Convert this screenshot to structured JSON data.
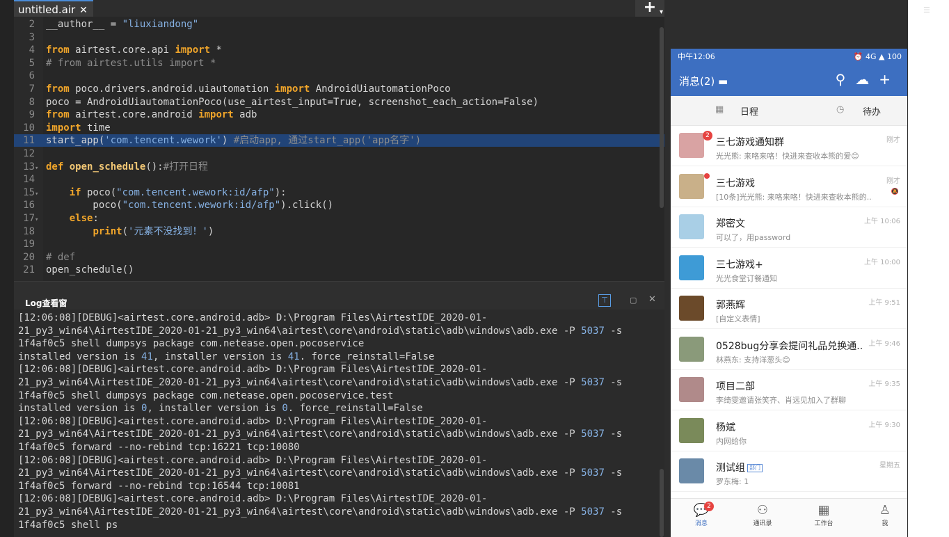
{
  "ide": {
    "tab_label": "untitled.air",
    "tab_close": "✕",
    "new_button": "+",
    "code_lines": [
      {
        "n": "2",
        "fold": "",
        "html": "__author__ = <span class=\"str\">\"liuxiandong\"</span>"
      },
      {
        "n": "3",
        "fold": "",
        "html": ""
      },
      {
        "n": "4",
        "fold": "",
        "html": "<span class=\"kw\">from</span> airtest.core.api <span class=\"kw\">import</span> *"
      },
      {
        "n": "5",
        "fold": "",
        "html": "<span class=\"cm\"># from airtest.utils import *</span>"
      },
      {
        "n": "6",
        "fold": "",
        "html": ""
      },
      {
        "n": "7",
        "fold": "",
        "html": "<span class=\"kw\">from</span> poco.drivers.android.uiautomation <span class=\"kw\">import</span> AndroidUiautomationPoco"
      },
      {
        "n": "8",
        "fold": "",
        "html": "poco = AndroidUiautomationPoco(use_airtest_input=True, screenshot_each_action=False)"
      },
      {
        "n": "9",
        "fold": "",
        "html": "<span class=\"kw\">from</span> airtest.core.android <span class=\"kw\">import</span> adb"
      },
      {
        "n": "10",
        "fold": "",
        "html": "<span class=\"kw\">import</span> time"
      },
      {
        "n": "11",
        "fold": "",
        "html": "start_app(<span class=\"str\">'com.tencent.wework'</span>) <span class=\"cm\">#启动app, 通过start_app('app名字')</span>"
      },
      {
        "n": "12",
        "fold": "",
        "html": ""
      },
      {
        "n": "13",
        "fold": "▾",
        "html": "<span class=\"kw\">def</span> <span class=\"fn\">open_schedule</span>():<span class=\"cm\">#打开日程</span>"
      },
      {
        "n": "14",
        "fold": "",
        "html": ""
      },
      {
        "n": "15",
        "fold": "▾",
        "html": "    <span class=\"kw\">if</span> poco(<span class=\"str\">\"com.tencent.wework:id/afp\"</span>):"
      },
      {
        "n": "16",
        "fold": "",
        "html": "        poco(<span class=\"str\">\"com.tencent.wework:id/afp\"</span>).click()"
      },
      {
        "n": "17",
        "fold": "▾",
        "html": "    <span class=\"kw\">else</span>:"
      },
      {
        "n": "18",
        "fold": "",
        "html": "        <span class=\"kw\">print</span>(<span class=\"str\">'元素不没找到！'</span>)"
      },
      {
        "n": "19",
        "fold": "",
        "html": ""
      },
      {
        "n": "20",
        "fold": "",
        "html": "<span class=\"cm\"># def</span>"
      },
      {
        "n": "21",
        "fold": "",
        "html": "open_schedule()"
      }
    ],
    "log": {
      "title": "Log查看窗",
      "lines": [
        "[12:06:08][DEBUG]<airtest.core.android.adb> D:\\Program Files\\AirtestIDE_2020-01-",
        "21_py3_win64\\AirtestIDE_2020-01-21_py3_win64\\airtest\\core\\android\\static\\adb\\windows\\adb.exe -P <span class=\"n\">5037</span> -s",
        "1f4af0c5 shell dumpsys package com.netease.open.pocoservice",
        "installed version is <span class=\"n\">41</span>, installer version is <span class=\"n\">41</span>. force_reinstall=False",
        "[12:06:08][DEBUG]<airtest.core.android.adb> D:\\Program Files\\AirtestIDE_2020-01-",
        "21_py3_win64\\AirtestIDE_2020-01-21_py3_win64\\airtest\\core\\android\\static\\adb\\windows\\adb.exe -P <span class=\"n\">5037</span> -s",
        "1f4af0c5 shell dumpsys package com.netease.open.pocoservice.test",
        "installed version is <span class=\"n\">0</span>, installer version is <span class=\"n\">0</span>. force_reinstall=False",
        "[12:06:08][DEBUG]<airtest.core.android.adb> D:\\Program Files\\AirtestIDE_2020-01-",
        "21_py3_win64\\AirtestIDE_2020-01-21_py3_win64\\airtest\\core\\android\\static\\adb\\windows\\adb.exe -P <span class=\"n\">5037</span> -s",
        "1f4af0c5 forward --no-rebind tcp:16221 tcp:10080",
        "[12:06:08][DEBUG]<airtest.core.android.adb> D:\\Program Files\\AirtestIDE_2020-01-",
        "21_py3_win64\\AirtestIDE_2020-01-21_py3_win64\\airtest\\core\\android\\static\\adb\\windows\\adb.exe -P <span class=\"n\">5037</span> -s",
        "1f4af0c5 forward --no-rebind tcp:16544 tcp:10081",
        "[12:06:08][DEBUG]<airtest.core.android.adb> D:\\Program Files\\AirtestIDE_2020-01-",
        "21_py3_win64\\AirtestIDE_2020-01-21_py3_win64\\airtest\\core\\android\\static\\adb\\windows\\adb.exe -P <span class=\"n\">5037</span> -s",
        "1f4af0c5 shell ps"
      ]
    }
  },
  "phone": {
    "status_time": "中午12:06",
    "status_right": "⏰ 4G ▲ 100",
    "title": "消息(2)",
    "quick_left": "日程",
    "quick_right": "待办",
    "conversations": [
      {
        "title": "三七游戏通知群",
        "sub": "光光熊: 来咯来咯！快进来查收本熊的爱😊",
        "time": "刚才",
        "badge": "2",
        "dot": false,
        "mute": "",
        "color": "#d9a3a3"
      },
      {
        "title": "三七游戏",
        "sub": "[10条]光光熊: 来咯来咯！快进来查收本熊的...",
        "time": "刚才",
        "badge": "",
        "dot": true,
        "mute": "🔕",
        "color": "#c9b089"
      },
      {
        "title": "郑密文",
        "sub": "可以了，用password",
        "time": "上午 10:06",
        "badge": "",
        "dot": false,
        "mute": "",
        "color": "#a9cfe6"
      },
      {
        "title": "三七游戏+",
        "sub": "光光食堂订餐通知",
        "time": "上午 10:00",
        "badge": "",
        "dot": false,
        "mute": "",
        "color": "#3e9bd6"
      },
      {
        "title": "郭燕辉",
        "sub": "[自定义表情]",
        "time": "上午 9:51",
        "badge": "",
        "dot": false,
        "mute": "",
        "color": "#6b4a2a"
      },
      {
        "title": "0528bug分享会提问礼品兑换通...",
        "sub": "林燕东: 支持洋葱头😊",
        "time": "上午 9:46",
        "badge": "",
        "dot": false,
        "mute": "",
        "color": "#8a9a7a"
      },
      {
        "title": "项目二部",
        "sub": "李绮雯邀请张笑齐、肖远见加入了群聊",
        "time": "上午 9:35",
        "badge": "",
        "dot": false,
        "mute": "",
        "color": "#b08a8a"
      },
      {
        "title": "杨斌",
        "sub": "内网给你",
        "time": "上午 9:30",
        "badge": "",
        "dot": false,
        "mute": "",
        "color": "#7a8a5a"
      },
      {
        "title": "测试组",
        "sub": "罗东梅: 1",
        "time": "星期五",
        "badge": "",
        "dot": false,
        "mute": "",
        "color": "#6a8aa8",
        "tag": "部门"
      }
    ],
    "nav": [
      {
        "label": "消息",
        "icon": "💬",
        "active": true,
        "badge": "2"
      },
      {
        "label": "通讯录",
        "icon": "⚇",
        "active": false,
        "badge": ""
      },
      {
        "label": "工作台",
        "icon": "▦",
        "active": false,
        "badge": ""
      },
      {
        "label": "我",
        "icon": "♙",
        "active": false,
        "badge": ""
      }
    ]
  }
}
